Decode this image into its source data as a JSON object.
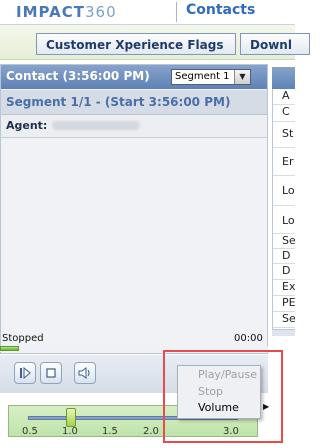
{
  "header": {
    "logo_main": "IMPACT",
    "logo_num": "360",
    "title": "Contacts"
  },
  "tabs": [
    {
      "label": "Customer Xperience Flags"
    },
    {
      "label": "Downl"
    }
  ],
  "contact_panel": {
    "title": "Contact (3:56:00 PM)",
    "segment_select": "Segment 1",
    "segment_line": "Segment 1/1 - (Start 3:56:00 PM)",
    "agent_label": "Agent:"
  },
  "right_column": {
    "rows": [
      "A",
      "C",
      "St",
      "Er",
      "Lo",
      "Lo",
      "Se",
      "D",
      "D",
      "Ex",
      "PE",
      "Se"
    ]
  },
  "status": {
    "text": "Stopped",
    "time": "00:00",
    "progress_percent": 7
  },
  "controls": {
    "play_icon": "play-pause-icon",
    "stop_icon": "stop-icon",
    "volume_icon": "speaker-icon"
  },
  "speed": {
    "ticks": [
      "0.5",
      "1.0",
      "1.5",
      "2.0",
      "3.0"
    ],
    "value": 1.0
  },
  "context_menu": {
    "items": [
      {
        "label": "Play/Pause",
        "enabled": false
      },
      {
        "label": "Stop",
        "enabled": false
      },
      {
        "label": "Volume",
        "enabled": true,
        "submenu": true
      }
    ]
  },
  "colors": {
    "accent": "#4a79b8",
    "highlight": "#e74b4b",
    "menu_disabled": "#9aa0a8"
  }
}
